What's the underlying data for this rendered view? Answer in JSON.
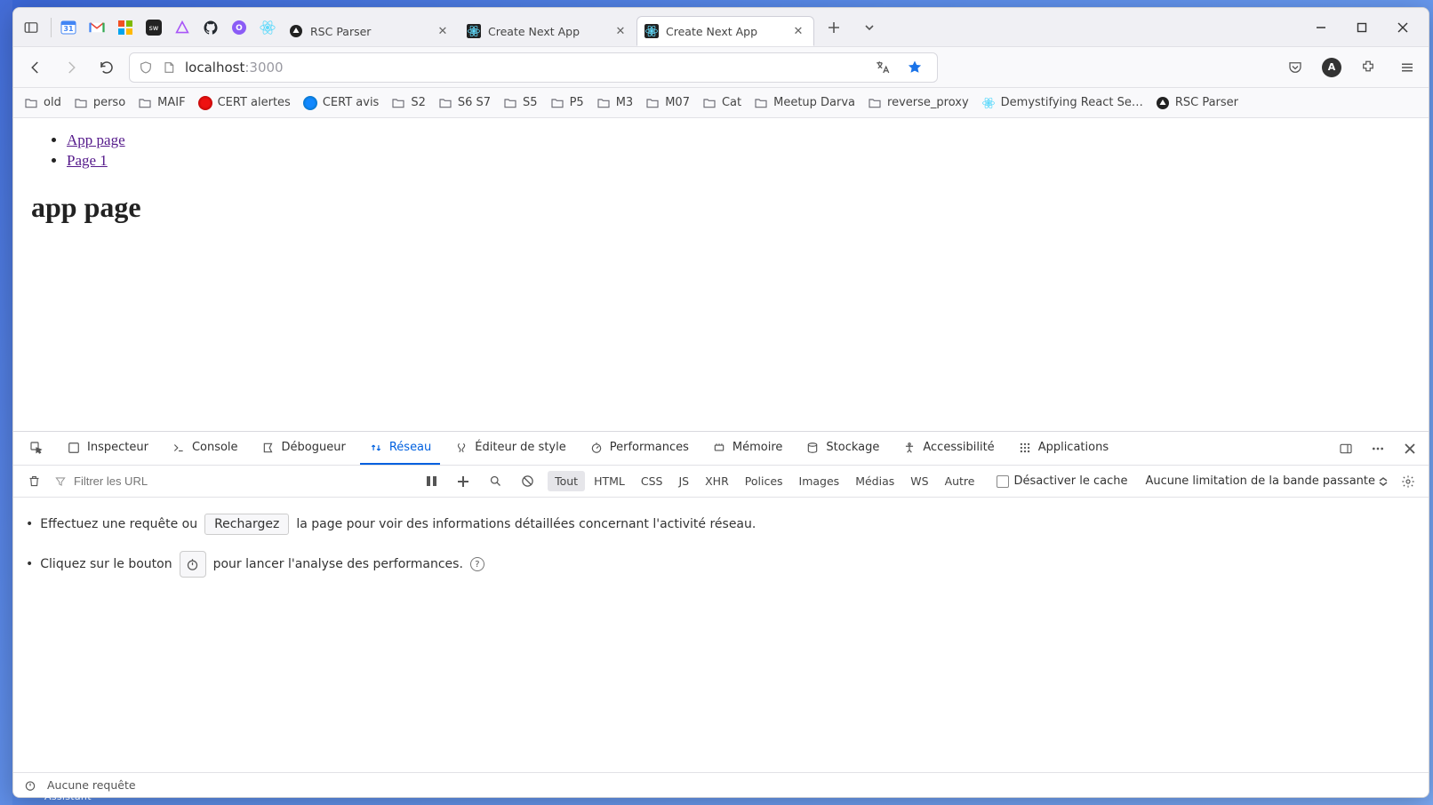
{
  "window": {
    "tabs": [
      {
        "title": "RSC Parser",
        "favicon": "triangle-dark"
      },
      {
        "title": "Create Next App",
        "favicon": "react-blue"
      },
      {
        "title": "Create Next App",
        "favicon": "react-blue",
        "active": true
      }
    ],
    "minimize": "–",
    "maximize": "▢",
    "close": "✕"
  },
  "address": {
    "host": "localhost",
    "port": ":3000"
  },
  "pinned": [
    "calendar",
    "gmail",
    "microsoft",
    "code-dark",
    "triangle",
    "github",
    "purple-o",
    "react"
  ],
  "bookmarks": [
    {
      "kind": "folder",
      "label": "old"
    },
    {
      "kind": "folder",
      "label": "perso"
    },
    {
      "kind": "folder",
      "label": "MAIF"
    },
    {
      "kind": "cert-red",
      "label": "CERT alertes"
    },
    {
      "kind": "cert-blue",
      "label": "CERT avis"
    },
    {
      "kind": "folder",
      "label": "S2"
    },
    {
      "kind": "folder",
      "label": "S6 S7"
    },
    {
      "kind": "folder",
      "label": "S5"
    },
    {
      "kind": "folder",
      "label": "P5"
    },
    {
      "kind": "folder",
      "label": "M3"
    },
    {
      "kind": "folder",
      "label": "M07"
    },
    {
      "kind": "folder",
      "label": "Cat"
    },
    {
      "kind": "folder",
      "label": "Meetup Darva"
    },
    {
      "kind": "folder",
      "label": "reverse_proxy"
    },
    {
      "kind": "react",
      "label": "Demystifying React Se…"
    },
    {
      "kind": "triangle-dark",
      "label": "RSC Parser"
    }
  ],
  "page": {
    "links": [
      {
        "text": "App page"
      },
      {
        "text": "Page 1"
      }
    ],
    "heading": "app page"
  },
  "devtools": {
    "tabs": [
      "Inspecteur",
      "Console",
      "Débogueur",
      "Réseau",
      "Éditeur de style",
      "Performances",
      "Mémoire",
      "Stockage",
      "Accessibilité",
      "Applications"
    ],
    "active_tab": "Réseau",
    "filter_placeholder": "Filtrer les URL",
    "type_filters": [
      "Tout",
      "HTML",
      "CSS",
      "JS",
      "XHR",
      "Polices",
      "Images",
      "Médias",
      "WS",
      "Autre"
    ],
    "active_type": "Tout",
    "disable_cache": "Désactiver le cache",
    "throttle": "Aucune limitation de la bande passante",
    "msg1_a": "Effectuez une requête ou",
    "msg1_btn": "Rechargez",
    "msg1_b": "la page pour voir des informations détaillées concernant l'activité réseau.",
    "msg2_a": "Cliquez sur le bouton",
    "msg2_b": "pour lancer l'analyse des performances.",
    "status": "Aucune requête"
  },
  "taskbar_hint": "Assistant"
}
